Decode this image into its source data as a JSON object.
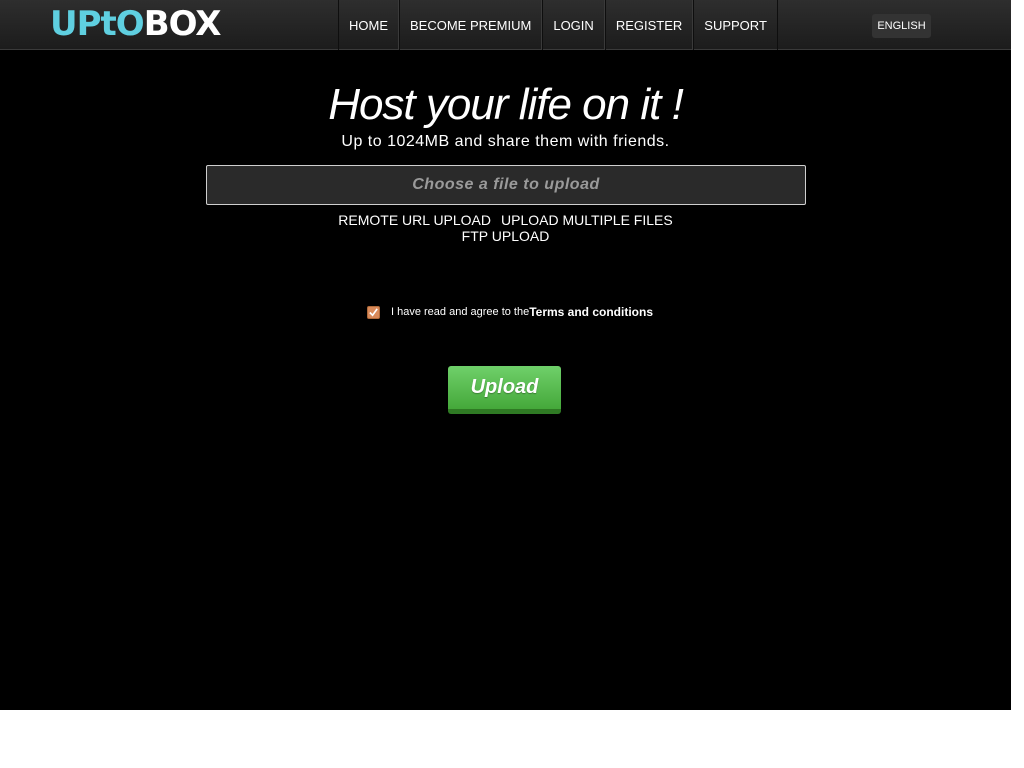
{
  "header": {
    "logo": {
      "part1": "UPtO",
      "part2": "BOX"
    },
    "nav": [
      {
        "label": "HOME"
      },
      {
        "label": "BECOME PREMIUM"
      },
      {
        "label": "LOGIN"
      },
      {
        "label": "REGISTER"
      },
      {
        "label": "SUPPORT"
      }
    ],
    "language": "ENGLISH"
  },
  "hero": {
    "title": "Host your life on it !",
    "subtitle": "Up to 1024MB and share them with friends."
  },
  "upload": {
    "file_prompt": "Choose a file to upload",
    "links": {
      "remote": "REMOTE URL UPLOAD",
      "multiple": "UPLOAD MULTIPLE FILES",
      "ftp": "FTP UPLOAD"
    },
    "terms_prefix": "I have read and agree to the",
    "terms_link": "Terms and conditions",
    "terms_checked": true,
    "button": "Upload"
  },
  "colors": {
    "background": "#000000",
    "logo_accent": "#5fcfe0",
    "button_green": "#5cbf52",
    "checkbox": "#d98a5a"
  }
}
